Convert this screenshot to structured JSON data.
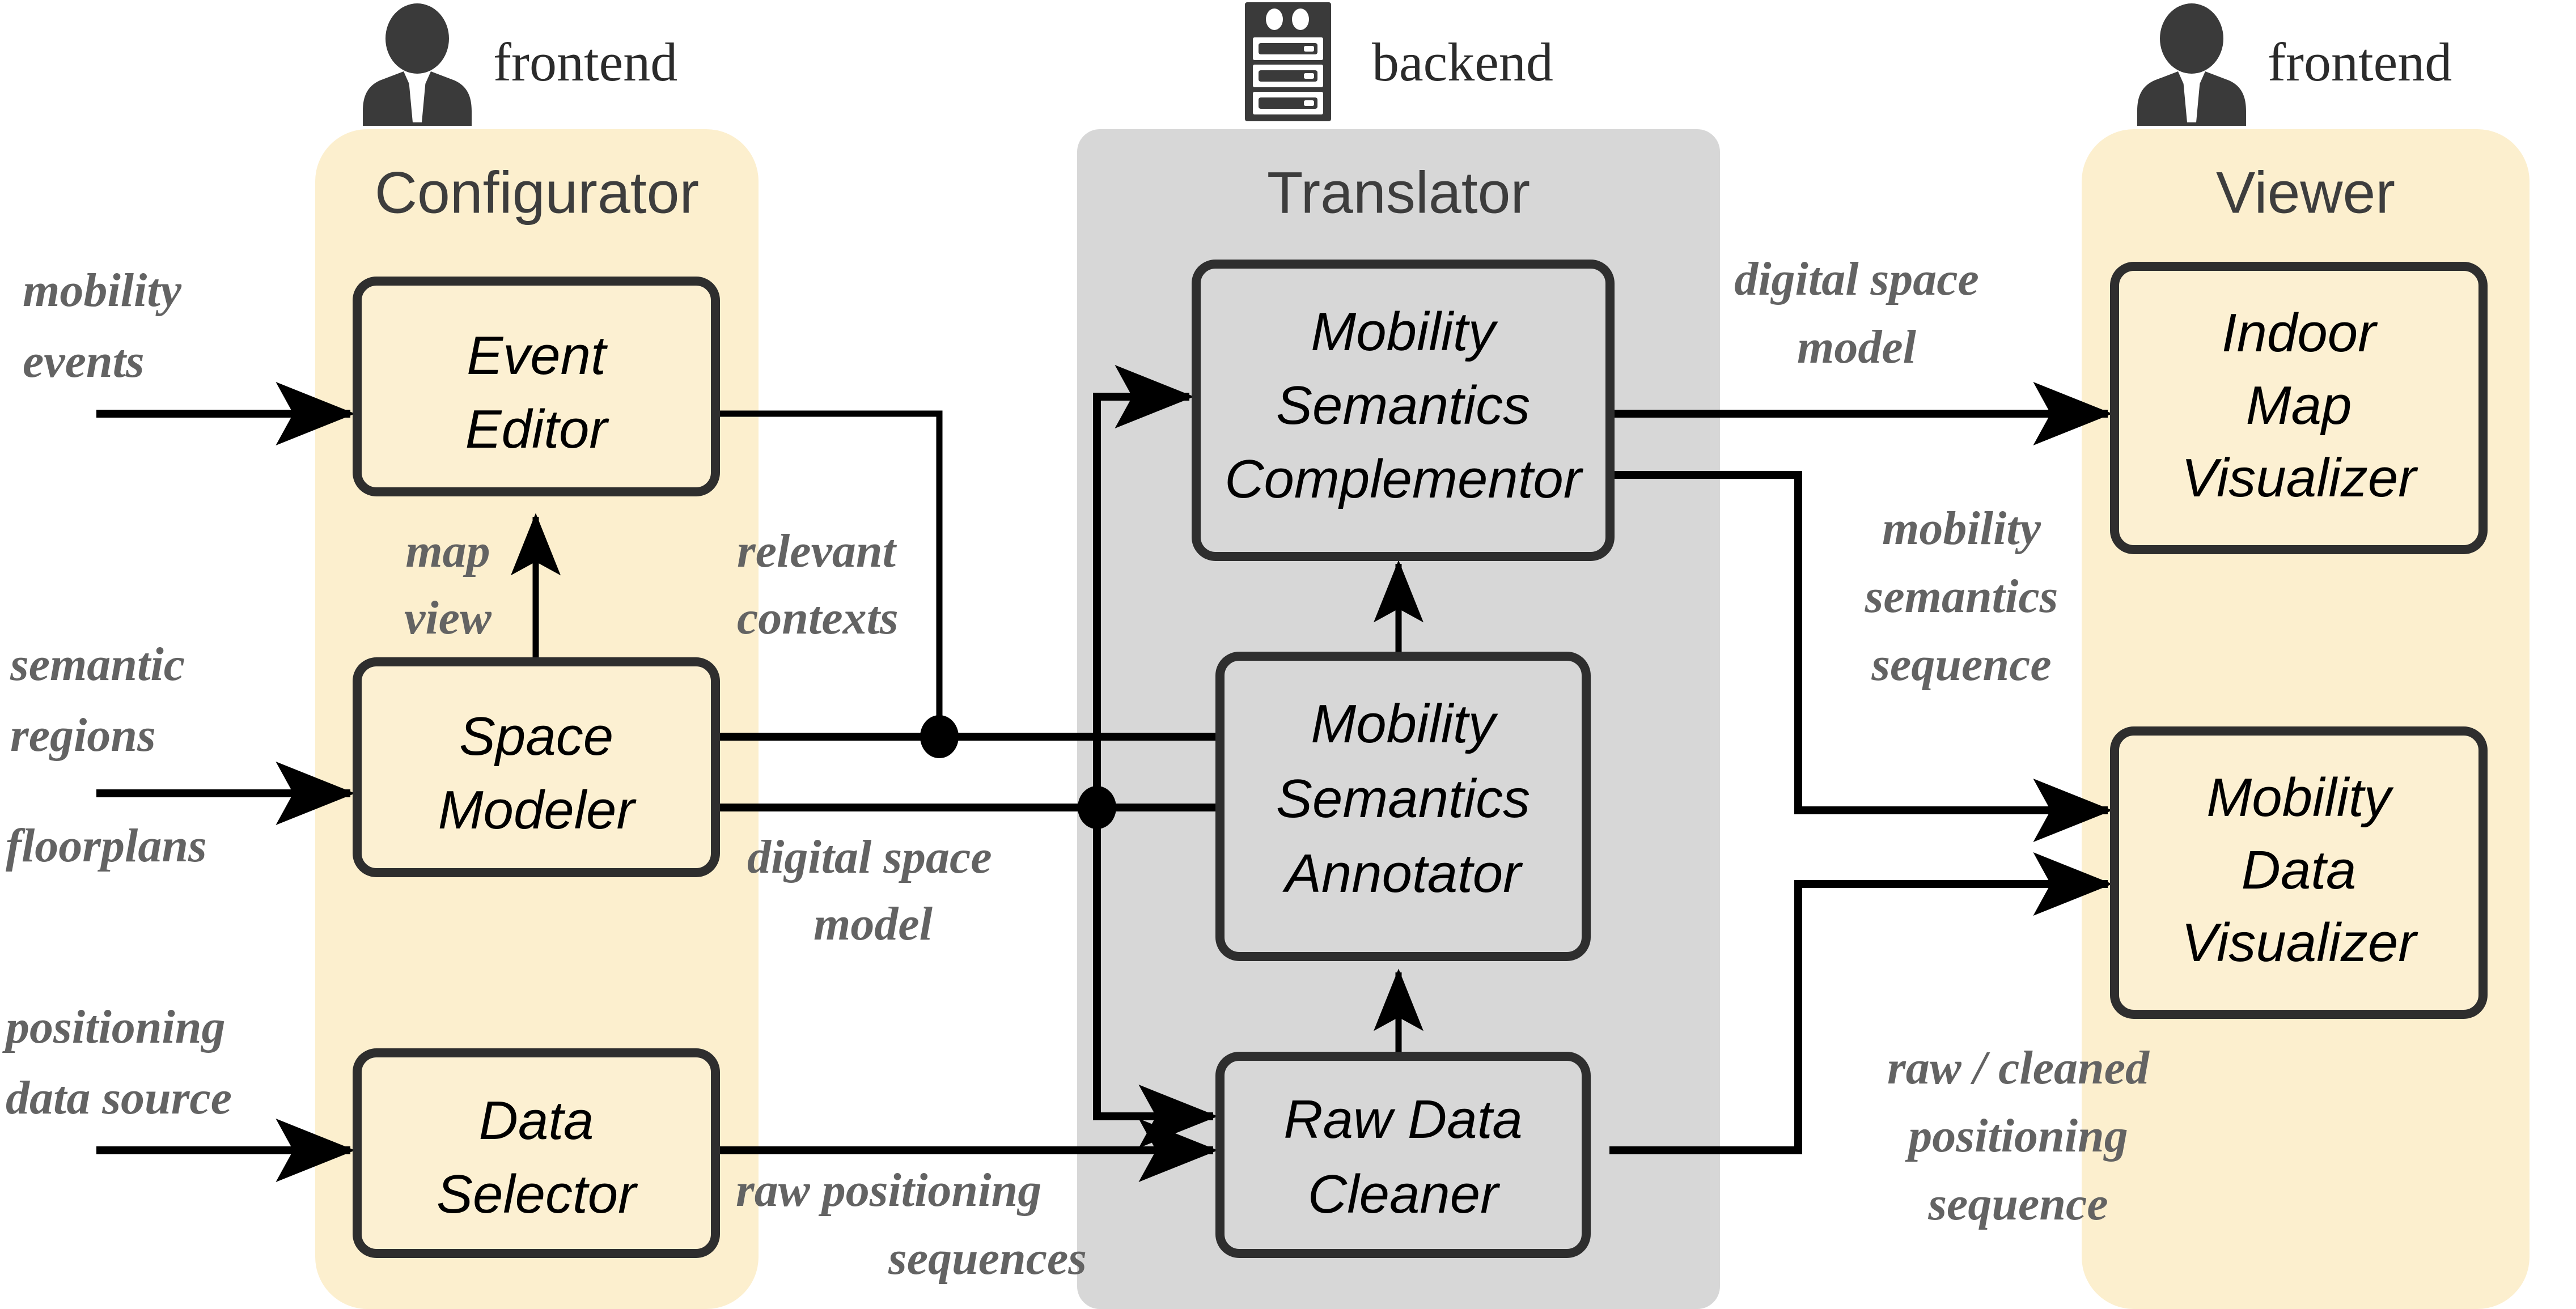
{
  "colors": {
    "frontend_panel": "#FCEFCE",
    "backend_panel": "#D7D7D7",
    "box_fill_frontend": "#FCF0D2",
    "box_fill_backend": "#D7D7D7",
    "box_border": "#2E2E2E",
    "wire": "#000000",
    "edge_label_text": "#636363",
    "panel_title_text": "#3D3D3D",
    "box_label_text": "#000000",
    "icon": "#3A3A3A",
    "background": "#FFFFFF"
  },
  "actors": [
    {
      "id": "actor-frontend-left",
      "icon": "person-icon",
      "label": "frontend"
    },
    {
      "id": "actor-backend",
      "icon": "server-icon",
      "label": "backend"
    },
    {
      "id": "actor-frontend-right",
      "icon": "person-icon",
      "label": "frontend"
    }
  ],
  "panels": [
    {
      "id": "panel-configurator",
      "title": "Configurator",
      "tier": "frontend"
    },
    {
      "id": "panel-translator",
      "title": "Translator",
      "tier": "backend"
    },
    {
      "id": "panel-viewer",
      "title": "Viewer",
      "tier": "frontend"
    }
  ],
  "boxes": [
    {
      "id": "box-event-editor",
      "panel": "panel-configurator",
      "lines": [
        "Event",
        "Editor"
      ]
    },
    {
      "id": "box-space-modeler",
      "panel": "panel-configurator",
      "lines": [
        "Space",
        "Modeler"
      ]
    },
    {
      "id": "box-data-selector",
      "panel": "panel-configurator",
      "lines": [
        "Data",
        "Selector"
      ]
    },
    {
      "id": "box-mobility-semantics-complementor",
      "panel": "panel-translator",
      "lines": [
        "Mobility",
        "Semantics",
        "Complementor"
      ]
    },
    {
      "id": "box-mobility-semantics-annotator",
      "panel": "panel-translator",
      "lines": [
        "Mobility",
        "Semantics",
        "Annotator"
      ]
    },
    {
      "id": "box-raw-data-cleaner",
      "panel": "panel-translator",
      "lines": [
        "Raw Data",
        "Cleaner"
      ]
    },
    {
      "id": "box-indoor-map-visualizer",
      "panel": "panel-viewer",
      "lines": [
        "Indoor",
        "Map",
        "Visualizer"
      ]
    },
    {
      "id": "box-mobility-data-visualizer",
      "panel": "panel-viewer",
      "lines": [
        "Mobility",
        "Data",
        "Visualizer"
      ]
    }
  ],
  "edge_labels": [
    {
      "id": "label-mobility-events",
      "lines": [
        "mobility",
        "events"
      ]
    },
    {
      "id": "label-semantic-regions",
      "lines": [
        "semantic",
        "regions"
      ]
    },
    {
      "id": "label-floorplans",
      "lines": [
        "floorplans"
      ]
    },
    {
      "id": "label-positioning-data-source",
      "lines": [
        "positioning",
        "data source"
      ]
    },
    {
      "id": "label-map-view",
      "lines": [
        "map",
        "view"
      ]
    },
    {
      "id": "label-relevant-contexts",
      "lines": [
        "relevant",
        "contexts"
      ]
    },
    {
      "id": "label-digital-space-model-left",
      "lines": [
        "digital space",
        "model"
      ]
    },
    {
      "id": "label-raw-positioning-sequences",
      "lines": [
        "raw positioning",
        "sequences"
      ]
    },
    {
      "id": "label-digital-space-model-right",
      "lines": [
        "digital space",
        "model"
      ]
    },
    {
      "id": "label-mobility-semantics-sequence",
      "lines": [
        "mobility",
        "semantics",
        "sequence"
      ]
    },
    {
      "id": "label-raw-cleaned-positioning-sequence",
      "lines": [
        "raw / cleaned",
        "positioning",
        "sequence"
      ]
    }
  ]
}
